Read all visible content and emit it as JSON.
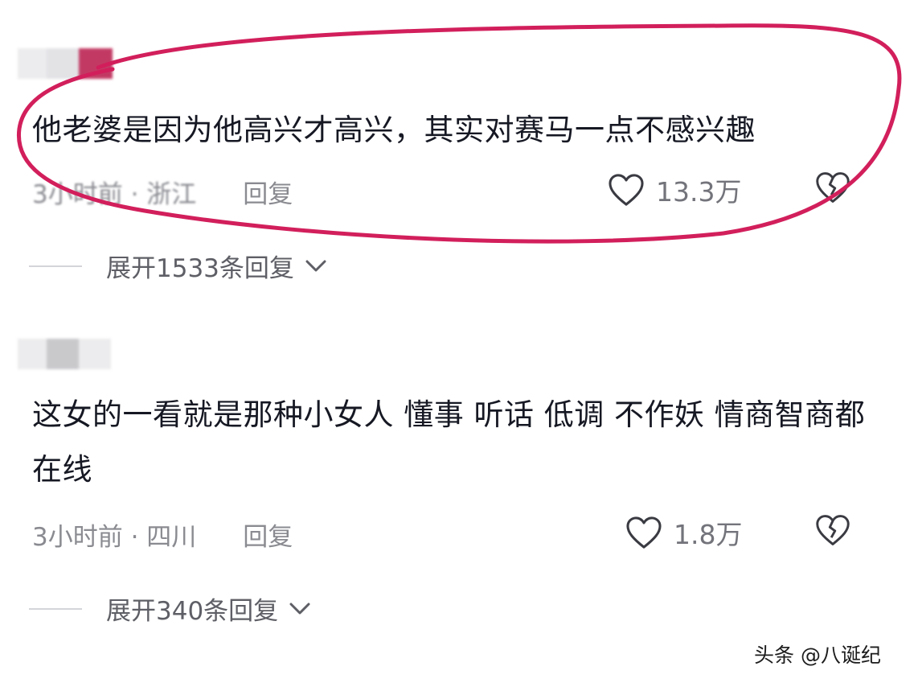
{
  "comments": [
    {
      "text": "他老婆是因为他高兴才高兴，其实对赛马一点不感兴趣",
      "time_location": "3小时前 · 浙江",
      "reply_label": "回复",
      "likes": "13.3万",
      "expand_label": "展开1533条回复",
      "username_blurred": true,
      "highlighted": true,
      "highlight_color": "#d21f5c"
    },
    {
      "text": "这女的一看就是那种小女人 懂事 听话 低调 不作妖 情商智商都在线",
      "time_location": "3小时前 · 四川",
      "reply_label": "回复",
      "likes": "1.8万",
      "expand_label": "展开340条回复",
      "username_blurred": true,
      "highlighted": false
    }
  ],
  "icons": {
    "like": "heart-outline-icon",
    "dislike": "broken-heart-icon",
    "expand": "chevron-down-icon"
  },
  "watermark": "头条 @八诞纪",
  "colors": {
    "text_primary": "#161823",
    "text_meta": "#8a8b91",
    "annotation": "#d21f5c"
  }
}
